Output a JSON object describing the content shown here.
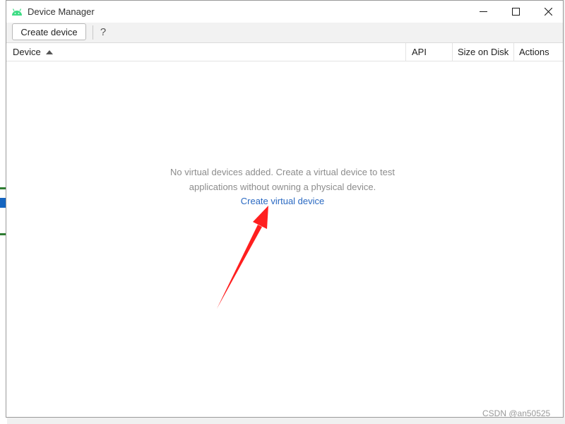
{
  "window": {
    "title": "Device Manager",
    "app_icon": "android-icon",
    "controls": [
      "minimize-icon",
      "maximize-icon",
      "close-icon"
    ]
  },
  "toolbar": {
    "create_label": "Create device",
    "help_label": "?"
  },
  "table": {
    "columns": [
      "Device",
      "API",
      "Size on Disk",
      "Actions"
    ],
    "sort_column": "Device",
    "sort_direction": "ascending"
  },
  "empty_state": {
    "line1": "No virtual devices added. Create a virtual device to test",
    "line2": "applications without owning a physical device.",
    "link": "Create virtual device"
  },
  "watermark": "CSDN @an50525",
  "colors": {
    "accent_link": "#2a69c2",
    "android_green": "#3ddc84",
    "annotation_arrow": "#ff1f1f"
  }
}
